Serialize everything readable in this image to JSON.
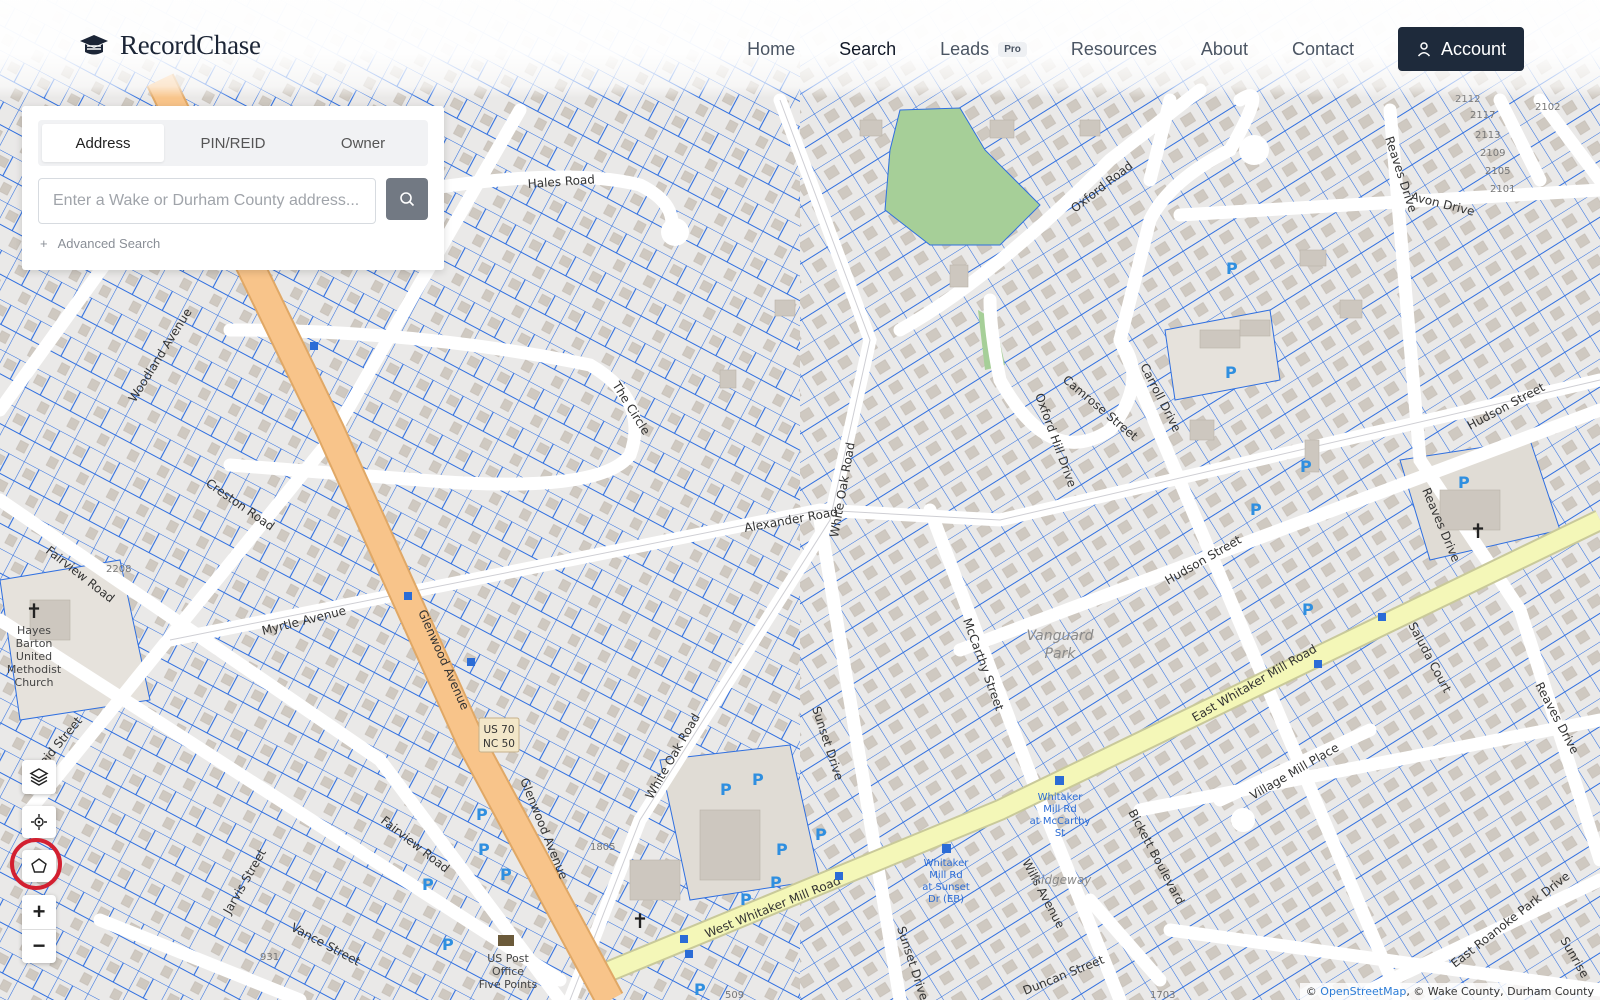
{
  "brand": {
    "name": "RecordChase"
  },
  "nav": {
    "items": [
      {
        "label": "Home"
      },
      {
        "label": "Search"
      },
      {
        "label": "Leads",
        "badge": "Pro"
      },
      {
        "label": "Resources"
      },
      {
        "label": "About"
      },
      {
        "label": "Contact"
      }
    ],
    "account_label": "Account"
  },
  "search": {
    "tabs": [
      "Address",
      "PIN/REID",
      "Owner"
    ],
    "active_tab": "Address",
    "placeholder": "Enter a Wake or Durham County address...",
    "value": "",
    "advanced_label": "Advanced Search"
  },
  "map": {
    "streets": {
      "hales": "Hales Road",
      "oxford": "Oxford Road",
      "reaves_top": "Reaves Drive",
      "avon": "Avon Drive",
      "circle": "The Circle",
      "woodland": "Woodland Avenue",
      "creston": "Creston Road",
      "fairview": "Fairview Road",
      "myrtle": "Myrtle Avenue",
      "glenwood": "Glenwood Avenue",
      "alexander": "Alexander Road",
      "white_oak": "White Oak Road",
      "white_oak_lower": "White Oak Road",
      "camrose": "Camrose Street",
      "oxford_hill": "Oxford Hill Drive",
      "carroll": "Carroll Drive",
      "hudson": "Hudson Street",
      "hudson_right": "Hudson Street",
      "reaves_mid": "Reaves Drive",
      "mccarthy": "McCarthy Street",
      "sunset": "Sunset Drive",
      "sunset_lower": "Sunset Drive",
      "east_whitaker": "East Whitaker Mill Road",
      "west_whitaker": "West Whitaker Mill Road",
      "saluda": "Saluda Court",
      "reaves_lower": "Reaves Drive",
      "village_mill": "Village Mill Place",
      "bickett": "Bickett Boulevard",
      "wills": "Wills Avenue",
      "reid": "Reid Street",
      "fairview_lower": "Fairview Road",
      "jarvis": "Jarvis Street",
      "vance": "Vance Street",
      "duncan": "Duncan Street",
      "roanoke": "East Roanoke Park Drive",
      "glenwood_lower": "Glenwood Avenue",
      "sunrise": "Sunrise"
    },
    "route_shield": [
      "US 70",
      "NC 50"
    ],
    "park_labels": [
      "Vanguard",
      "Park"
    ],
    "area_label": "Ridgeway",
    "church_label": [
      "Hayes",
      "Barton",
      "United",
      "Methodist",
      "Church"
    ],
    "post_office_label": [
      "US Post",
      "Office",
      "Five Points"
    ],
    "bus_stops": [
      [
        "Whitaker",
        "Mill Rd",
        "at McCarthy",
        "St"
      ],
      [
        "Whitaker",
        "Mill Rd",
        "at Sunset",
        "Dr (EB)"
      ]
    ],
    "house_numbers": [
      "2208",
      "1805",
      "931",
      "509",
      "1703",
      "2117",
      "2113",
      "2109",
      "2105",
      "2101",
      "2102",
      "2112"
    ],
    "parking_symbol": "P",
    "colors": {
      "background": "#f2efe9",
      "parcel_line": "#2f6fe0",
      "trunk_road": "#f8c48a",
      "secondary_road": "#f4f7b8",
      "park": "#a6cf98",
      "building": "#cdc7bf"
    }
  },
  "controls": {
    "layers": "layers-icon",
    "locate": "locate-icon",
    "polygon": "polygon-draw-icon",
    "zoom_in": "+",
    "zoom_out": "−"
  },
  "attribution": {
    "prefix": "©",
    "link": "OpenStreetMap",
    "rest": ", © Wake County, Durham County"
  },
  "accent_color": "#1e2a3b",
  "highlight_ring_color": "#d32030"
}
